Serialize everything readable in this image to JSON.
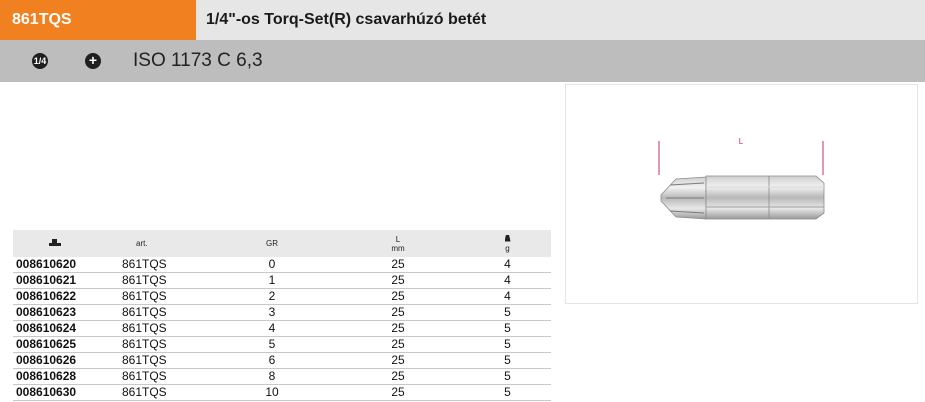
{
  "header": {
    "code": "861TQS",
    "title": "1/4\"-os Torq-Set(R) csavarhúzó betét"
  },
  "subheader": {
    "icons": [
      "quarter-inch-drive-icon",
      "torq-set-cross-icon"
    ],
    "icon_a_text": "1/4",
    "icon_b_text": "+",
    "standard": "ISO 1173 C 6,3"
  },
  "table": {
    "headers": {
      "art_no_icon": "product-code-icon",
      "name": "art.",
      "gr": "GR",
      "len_top": "L",
      "len_unit": "mm",
      "mass_icon": "weight-icon",
      "mass_unit": "g"
    },
    "rows": [
      {
        "code": "008610620",
        "art": "861TQS",
        "gr": "0",
        "l": "25",
        "g": "4"
      },
      {
        "code": "008610621",
        "art": "861TQS",
        "gr": "1",
        "l": "25",
        "g": "4"
      },
      {
        "code": "008610622",
        "art": "861TQS",
        "gr": "2",
        "l": "25",
        "g": "4"
      },
      {
        "code": "008610623",
        "art": "861TQS",
        "gr": "3",
        "l": "25",
        "g": "5"
      },
      {
        "code": "008610624",
        "art": "861TQS",
        "gr": "4",
        "l": "25",
        "g": "5"
      },
      {
        "code": "008610625",
        "art": "861TQS",
        "gr": "5",
        "l": "25",
        "g": "5"
      },
      {
        "code": "008610626",
        "art": "861TQS",
        "gr": "6",
        "l": "25",
        "g": "5"
      },
      {
        "code": "008610628",
        "art": "861TQS",
        "gr": "8",
        "l": "25",
        "g": "5"
      },
      {
        "code": "008610630",
        "art": "861TQS",
        "gr": "10",
        "l": "25",
        "g": "5"
      }
    ]
  },
  "image": {
    "dimension_label": "L",
    "accent_color": "#c0306a"
  },
  "colors": {
    "code_tab": "#f08020",
    "header_bg": "#e6e6e6",
    "subbar_bg": "#bdbdbd"
  }
}
